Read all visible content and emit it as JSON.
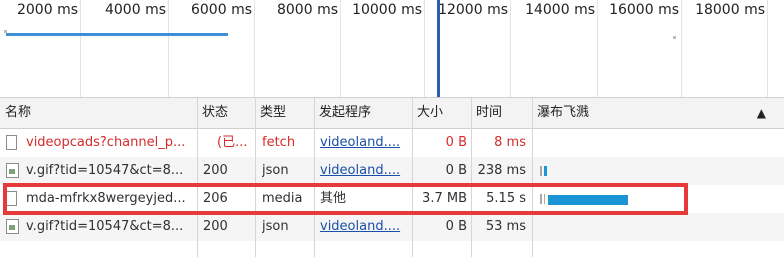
{
  "timeline": {
    "ticks": [
      "2000 ms",
      "4000 ms",
      "6000 ms",
      "8000 ms",
      "10000 ms",
      "12000 ms",
      "14000 ms",
      "16000 ms",
      "18000 ms"
    ]
  },
  "columns": {
    "name": "名称",
    "status": "状态",
    "type": "类型",
    "initiator": "发起程序",
    "size": "大小",
    "time": "时间",
    "waterfall": "瀑布飞溅",
    "sort_icon": "▲"
  },
  "rows": [
    {
      "name": "videopcads?channel_p...",
      "status": "(已...",
      "type": "fetch",
      "initiator": "videoland....",
      "size": "0 B",
      "time": "8 ms",
      "icon": "document-icon",
      "error": true
    },
    {
      "name": "v.gif?tid=10547&ct=8...",
      "status": "200",
      "type": "json",
      "initiator": "videoland....",
      "size": "0 B",
      "time": "238 ms",
      "icon": "image-icon",
      "error": false
    },
    {
      "name": "mda-mfrkx8wergeyjed...",
      "status": "206",
      "type": "media",
      "initiator": "其他",
      "size": "3.7 MB",
      "time": "5.15 s",
      "icon": "document-icon",
      "error": false
    },
    {
      "name": "v.gif?tid=10547&ct=8...",
      "status": "200",
      "type": "json",
      "initiator": "videoland....",
      "size": "0 B",
      "time": "53 ms",
      "icon": "image-icon",
      "error": false
    }
  ],
  "colors": {
    "accent": "#1a96d6",
    "error": "#d52b2b",
    "highlight": "#e63a3a",
    "cursor": "#2a5db0"
  }
}
